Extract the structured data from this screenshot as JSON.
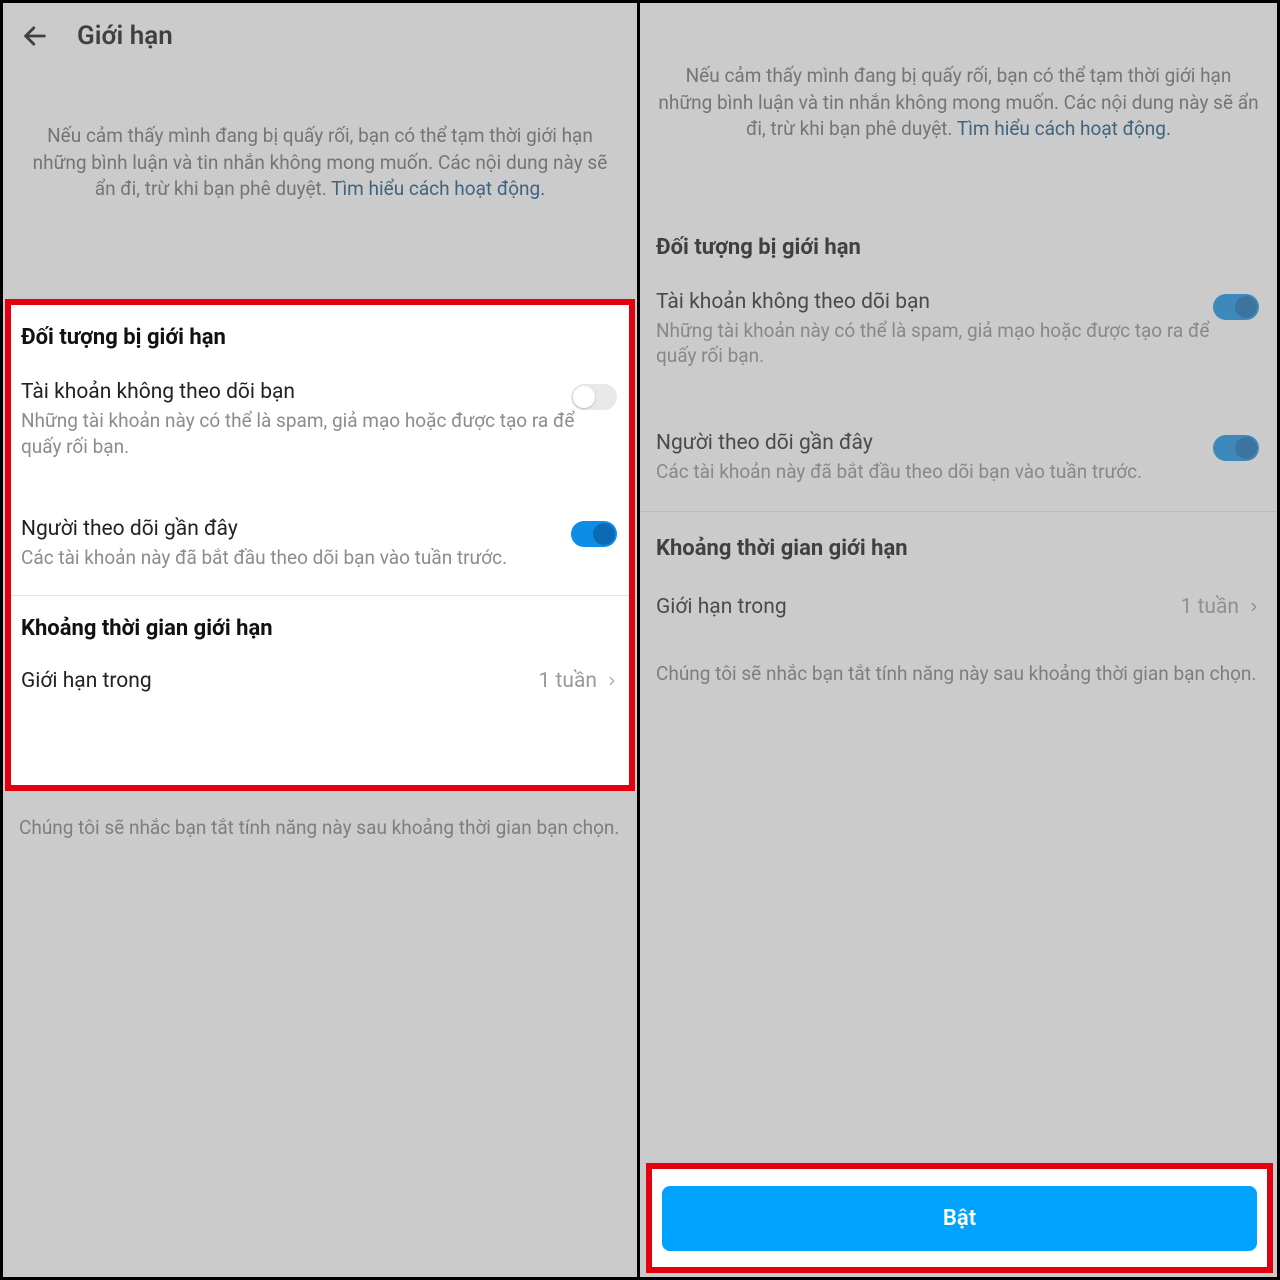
{
  "header": {
    "title": "Giới hạn"
  },
  "intro": {
    "text": "Nếu cảm thấy mình đang bị quấy rối, bạn có thể tạm thời giới hạn những bình luận và tin nhắn không mong muốn. Các nội dung này sẽ ẩn đi, trừ khi bạn phê duyệt. ",
    "link": "Tìm hiểu cách hoạt động."
  },
  "section1": {
    "heading": "Đối tượng bị giới hạn",
    "opt1": {
      "title": "Tài khoản không theo dõi bạn",
      "sub": "Những tài khoản này có thể là spam, giả mạo hoặc được tạo ra để quấy rối bạn."
    },
    "opt2": {
      "title": "Người theo dõi gần đây",
      "sub": "Các tài khoản này đã bắt đầu theo dõi bạn vào tuần trước."
    }
  },
  "section2": {
    "heading": "Khoảng thời gian giới hạn",
    "label": "Giới hạn trong",
    "value": "1 tuần"
  },
  "note": "Chúng tôi sẽ nhắc bạn tắt tính năng này sau khoảng thời gian bạn chọn.",
  "enable": "Bật"
}
